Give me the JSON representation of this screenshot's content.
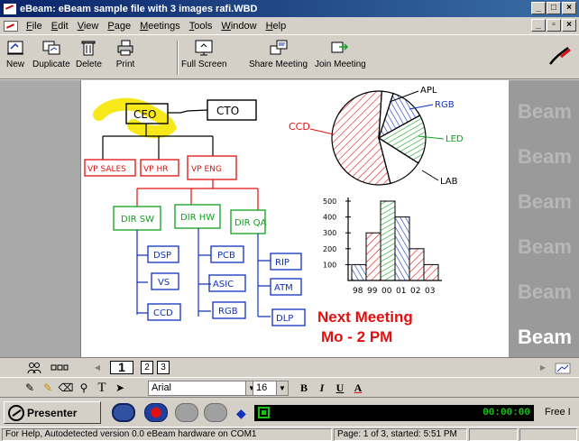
{
  "window": {
    "title": "eBeam: eBeam sample file with 3 images rafi.WBD",
    "controls": [
      "_",
      "□",
      "×"
    ]
  },
  "menu": {
    "items": [
      "File",
      "Edit",
      "View",
      "Page",
      "Meetings",
      "Tools",
      "Window",
      "Help"
    ],
    "doc_controls": [
      "_",
      "▫",
      "×"
    ]
  },
  "toolbar": {
    "buttons": [
      {
        "label": "New",
        "icon": "new-page-icon"
      },
      {
        "label": "Duplicate",
        "icon": "duplicate-icon"
      },
      {
        "label": "Delete",
        "icon": "trash-icon"
      },
      {
        "label": "Print",
        "icon": "printer-icon"
      },
      {
        "label": "Full Screen",
        "icon": "full-screen-icon"
      },
      {
        "label": "Share Meeting",
        "icon": "share-meeting-icon"
      },
      {
        "label": "Join Meeting",
        "icon": "join-meeting-icon"
      }
    ]
  },
  "whiteboard": {
    "org_chart": {
      "ceo": "CEO",
      "cto": "CTO",
      "vps": [
        "VP SALES",
        "VP HR",
        "VP ENG"
      ],
      "dirs": [
        "DIR SW",
        "DIR HW",
        "DIR QA"
      ],
      "sw_leaves": [
        "DSP",
        "VS",
        "CCD"
      ],
      "hw_leaves": [
        "PCB",
        "ASIC",
        "RGB"
      ],
      "qa_leaves": [
        "RIP",
        "ATM",
        "DLP"
      ]
    },
    "pie_labels": {
      "left": "CCD",
      "top": "APL",
      "upper_right": "RGB",
      "right": "LED",
      "bottom": "LAB"
    },
    "meeting_note": {
      "line1": "Next Meeting",
      "line2": "Mo - 2 PM",
      "color": "#e01010"
    },
    "watermark": "Beam"
  },
  "chart_data": [
    {
      "type": "pie",
      "labels": [
        "CCD",
        "APL",
        "RGB",
        "LED",
        "LAB"
      ],
      "values": [
        55,
        4,
        12,
        17,
        12
      ]
    },
    {
      "type": "bar",
      "categories": [
        "98",
        "99",
        "00",
        "01",
        "02",
        "03"
      ],
      "values": [
        100,
        300,
        500,
        400,
        200,
        100
      ],
      "yticks": [
        "500",
        "400",
        "300",
        "200",
        "100"
      ],
      "ylim": [
        0,
        500
      ]
    }
  ],
  "pagebar": {
    "pages": [
      "1",
      "2",
      "3"
    ],
    "active_page": "1"
  },
  "drawbar": {
    "font": "Arial",
    "size": "16",
    "bold": "B",
    "italic": "I",
    "underline": "U",
    "color_button": "A"
  },
  "presenter": {
    "label": "Presenter",
    "time": "00:00:00",
    "right_text": "Free I"
  },
  "status": {
    "help": "For Help, Autodetected version 0.0 eBeam hardware on COM1",
    "page": "Page: 1 of 3, started: 5:51 PM"
  },
  "colors": {
    "title_bar": "#0a246a",
    "pen_red": "#e01010",
    "pen_blue": "#1030c0",
    "pen_green": "#10a020",
    "highlighter": "#f5e600",
    "timer_green": "#18c018"
  }
}
